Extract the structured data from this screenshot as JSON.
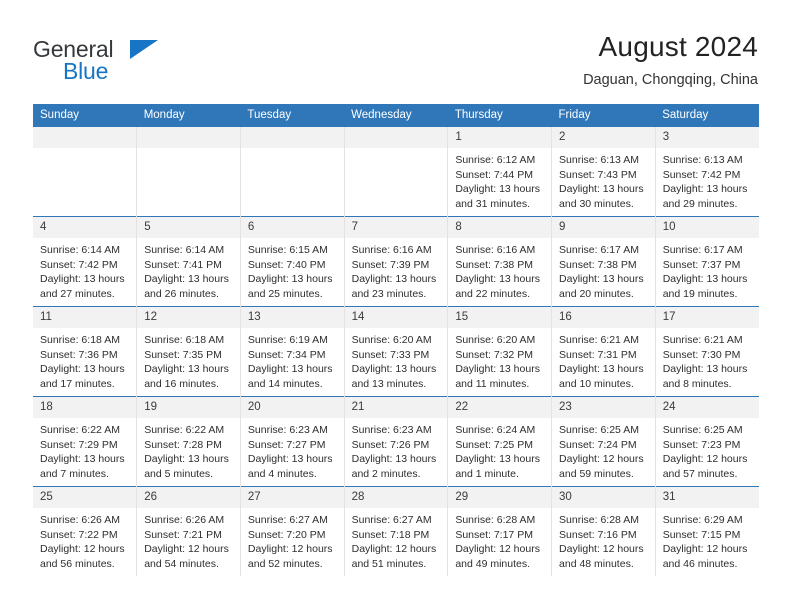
{
  "brand": {
    "name_part1": "General",
    "name_part2": "Blue",
    "logo_icon": "triangle-icon"
  },
  "header": {
    "title": "August 2024",
    "subtitle": "Daguan, Chongqing, China"
  },
  "colors": {
    "header_blue": "#3077b9",
    "brand_blue": "#1675c4",
    "daynum_band": "#f2f2f2",
    "column_divider": "#e2e2e2"
  },
  "calendar": {
    "weekday_headers": [
      "Sunday",
      "Monday",
      "Tuesday",
      "Wednesday",
      "Thursday",
      "Friday",
      "Saturday"
    ],
    "weeks": [
      [
        {
          "day": "",
          "lines": []
        },
        {
          "day": "",
          "lines": []
        },
        {
          "day": "",
          "lines": []
        },
        {
          "day": "",
          "lines": []
        },
        {
          "day": "1",
          "lines": [
            "Sunrise: 6:12 AM",
            "Sunset: 7:44 PM",
            "Daylight: 13 hours",
            "and 31 minutes."
          ]
        },
        {
          "day": "2",
          "lines": [
            "Sunrise: 6:13 AM",
            "Sunset: 7:43 PM",
            "Daylight: 13 hours",
            "and 30 minutes."
          ]
        },
        {
          "day": "3",
          "lines": [
            "Sunrise: 6:13 AM",
            "Sunset: 7:42 PM",
            "Daylight: 13 hours",
            "and 29 minutes."
          ]
        }
      ],
      [
        {
          "day": "4",
          "lines": [
            "Sunrise: 6:14 AM",
            "Sunset: 7:42 PM",
            "Daylight: 13 hours",
            "and 27 minutes."
          ]
        },
        {
          "day": "5",
          "lines": [
            "Sunrise: 6:14 AM",
            "Sunset: 7:41 PM",
            "Daylight: 13 hours",
            "and 26 minutes."
          ]
        },
        {
          "day": "6",
          "lines": [
            "Sunrise: 6:15 AM",
            "Sunset: 7:40 PM",
            "Daylight: 13 hours",
            "and 25 minutes."
          ]
        },
        {
          "day": "7",
          "lines": [
            "Sunrise: 6:16 AM",
            "Sunset: 7:39 PM",
            "Daylight: 13 hours",
            "and 23 minutes."
          ]
        },
        {
          "day": "8",
          "lines": [
            "Sunrise: 6:16 AM",
            "Sunset: 7:38 PM",
            "Daylight: 13 hours",
            "and 22 minutes."
          ]
        },
        {
          "day": "9",
          "lines": [
            "Sunrise: 6:17 AM",
            "Sunset: 7:38 PM",
            "Daylight: 13 hours",
            "and 20 minutes."
          ]
        },
        {
          "day": "10",
          "lines": [
            "Sunrise: 6:17 AM",
            "Sunset: 7:37 PM",
            "Daylight: 13 hours",
            "and 19 minutes."
          ]
        }
      ],
      [
        {
          "day": "11",
          "lines": [
            "Sunrise: 6:18 AM",
            "Sunset: 7:36 PM",
            "Daylight: 13 hours",
            "and 17 minutes."
          ]
        },
        {
          "day": "12",
          "lines": [
            "Sunrise: 6:18 AM",
            "Sunset: 7:35 PM",
            "Daylight: 13 hours",
            "and 16 minutes."
          ]
        },
        {
          "day": "13",
          "lines": [
            "Sunrise: 6:19 AM",
            "Sunset: 7:34 PM",
            "Daylight: 13 hours",
            "and 14 minutes."
          ]
        },
        {
          "day": "14",
          "lines": [
            "Sunrise: 6:20 AM",
            "Sunset: 7:33 PM",
            "Daylight: 13 hours",
            "and 13 minutes."
          ]
        },
        {
          "day": "15",
          "lines": [
            "Sunrise: 6:20 AM",
            "Sunset: 7:32 PM",
            "Daylight: 13 hours",
            "and 11 minutes."
          ]
        },
        {
          "day": "16",
          "lines": [
            "Sunrise: 6:21 AM",
            "Sunset: 7:31 PM",
            "Daylight: 13 hours",
            "and 10 minutes."
          ]
        },
        {
          "day": "17",
          "lines": [
            "Sunrise: 6:21 AM",
            "Sunset: 7:30 PM",
            "Daylight: 13 hours",
            "and 8 minutes."
          ]
        }
      ],
      [
        {
          "day": "18",
          "lines": [
            "Sunrise: 6:22 AM",
            "Sunset: 7:29 PM",
            "Daylight: 13 hours",
            "and 7 minutes."
          ]
        },
        {
          "day": "19",
          "lines": [
            "Sunrise: 6:22 AM",
            "Sunset: 7:28 PM",
            "Daylight: 13 hours",
            "and 5 minutes."
          ]
        },
        {
          "day": "20",
          "lines": [
            "Sunrise: 6:23 AM",
            "Sunset: 7:27 PM",
            "Daylight: 13 hours",
            "and 4 minutes."
          ]
        },
        {
          "day": "21",
          "lines": [
            "Sunrise: 6:23 AM",
            "Sunset: 7:26 PM",
            "Daylight: 13 hours",
            "and 2 minutes."
          ]
        },
        {
          "day": "22",
          "lines": [
            "Sunrise: 6:24 AM",
            "Sunset: 7:25 PM",
            "Daylight: 13 hours",
            "and 1 minute."
          ]
        },
        {
          "day": "23",
          "lines": [
            "Sunrise: 6:25 AM",
            "Sunset: 7:24 PM",
            "Daylight: 12 hours",
            "and 59 minutes."
          ]
        },
        {
          "day": "24",
          "lines": [
            "Sunrise: 6:25 AM",
            "Sunset: 7:23 PM",
            "Daylight: 12 hours",
            "and 57 minutes."
          ]
        }
      ],
      [
        {
          "day": "25",
          "lines": [
            "Sunrise: 6:26 AM",
            "Sunset: 7:22 PM",
            "Daylight: 12 hours",
            "and 56 minutes."
          ]
        },
        {
          "day": "26",
          "lines": [
            "Sunrise: 6:26 AM",
            "Sunset: 7:21 PM",
            "Daylight: 12 hours",
            "and 54 minutes."
          ]
        },
        {
          "day": "27",
          "lines": [
            "Sunrise: 6:27 AM",
            "Sunset: 7:20 PM",
            "Daylight: 12 hours",
            "and 52 minutes."
          ]
        },
        {
          "day": "28",
          "lines": [
            "Sunrise: 6:27 AM",
            "Sunset: 7:18 PM",
            "Daylight: 12 hours",
            "and 51 minutes."
          ]
        },
        {
          "day": "29",
          "lines": [
            "Sunrise: 6:28 AM",
            "Sunset: 7:17 PM",
            "Daylight: 12 hours",
            "and 49 minutes."
          ]
        },
        {
          "day": "30",
          "lines": [
            "Sunrise: 6:28 AM",
            "Sunset: 7:16 PM",
            "Daylight: 12 hours",
            "and 48 minutes."
          ]
        },
        {
          "day": "31",
          "lines": [
            "Sunrise: 6:29 AM",
            "Sunset: 7:15 PM",
            "Daylight: 12 hours",
            "and 46 minutes."
          ]
        }
      ]
    ]
  }
}
